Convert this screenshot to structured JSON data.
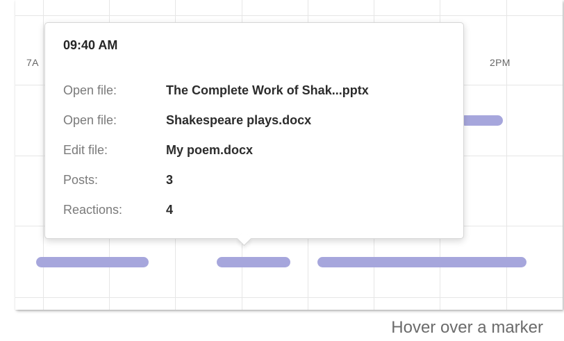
{
  "timeline": {
    "time_labels": [
      "7A",
      "2PM"
    ]
  },
  "tooltip": {
    "time": "09:40 AM",
    "rows": [
      {
        "label": "Open file:",
        "value": "The Complete Work of Shak...pptx"
      },
      {
        "label": "Open file:",
        "value": "Shakespeare plays.docx"
      },
      {
        "label": "Edit file:",
        "value": "My poem.docx"
      },
      {
        "label": "Posts:",
        "value": "3"
      },
      {
        "label": "Reactions:",
        "value": "4"
      }
    ]
  },
  "caption": "Hover over a marker",
  "colors": {
    "activity_bar": "#a6a6dc",
    "grid_line": "#e6e6e6"
  }
}
